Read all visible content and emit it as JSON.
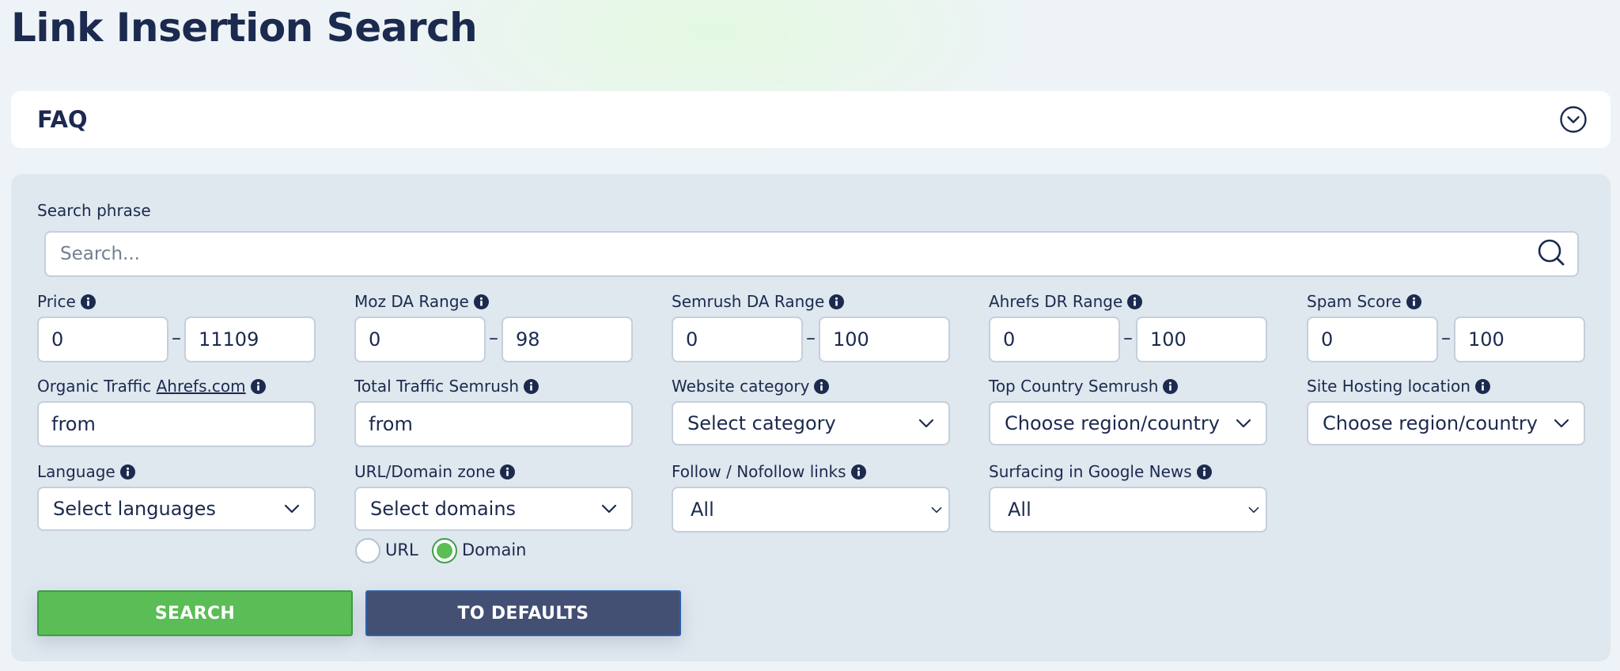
{
  "page": {
    "title": "Link Insertion Search"
  },
  "faq": {
    "label": "FAQ"
  },
  "search": {
    "label": "Search phrase",
    "placeholder": "Search..."
  },
  "filters": {
    "price": {
      "label": "Price",
      "from": "0",
      "to": "11109"
    },
    "moz_da": {
      "label": "Moz DA Range",
      "from": "0",
      "to": "98"
    },
    "semrush_da": {
      "label": "Semrush DA Range",
      "from": "0",
      "to": "100"
    },
    "ahrefs_dr": {
      "label": "Ahrefs DR Range",
      "from": "0",
      "to": "100"
    },
    "spam_score": {
      "label": "Spam Score",
      "from": "0",
      "to": "100"
    },
    "organic_traffic": {
      "label_prefix": "Organic Traffic ",
      "label_link": "Ahrefs.com",
      "value": "from"
    },
    "total_traffic": {
      "label": "Total Traffic Semrush",
      "value": "from"
    },
    "website_category": {
      "label": "Website category",
      "value": "Select category"
    },
    "top_country": {
      "label": "Top Country Semrush",
      "value": "Choose region/country"
    },
    "hosting_location": {
      "label": "Site Hosting location",
      "value": "Choose region/country"
    },
    "language": {
      "label": "Language",
      "value": "Select languages"
    },
    "domain_zone": {
      "label": "URL/Domain zone",
      "value": "Select domains",
      "radio_url": "URL",
      "radio_domain": "Domain",
      "selected": "Domain"
    },
    "follow": {
      "label": "Follow / Nofollow links",
      "value": "All"
    },
    "google_news": {
      "label": "Surfacing in Google News",
      "value": "All"
    }
  },
  "buttons": {
    "search": "SEARCH",
    "defaults": "TO DEFAULTS"
  },
  "colors": {
    "accent_green": "#5bbd55",
    "secondary_navy": "#434f73",
    "text_dark": "#1b2a4e",
    "panel_bg": "#dfe7ef"
  }
}
